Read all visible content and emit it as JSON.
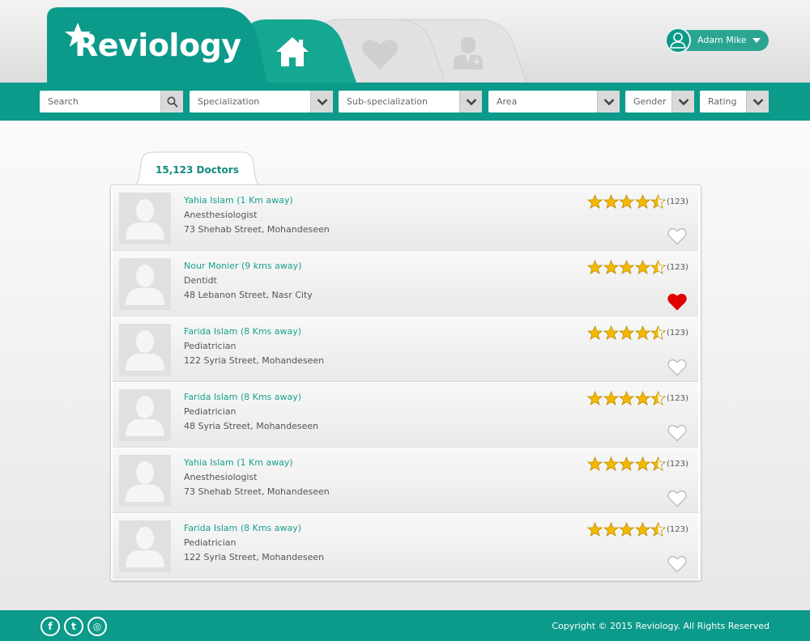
{
  "brand": {
    "name": "Reviology",
    "color": "#0c9a8a"
  },
  "nav": {
    "items": [
      {
        "id": "home",
        "icon": "home-icon",
        "active": true
      },
      {
        "id": "favorites",
        "icon": "heart-icon",
        "active": false
      },
      {
        "id": "doctors",
        "icon": "doctor-icon",
        "active": false
      }
    ]
  },
  "user": {
    "name": "Adam Mike",
    "icon": "user-icon"
  },
  "filters": {
    "search": {
      "placeholder": "Search"
    },
    "specialization": "Specialization",
    "sub_specialization": "Sub-specialization",
    "area": "Area",
    "gender": "Gender",
    "rating": "Rating"
  },
  "list": {
    "title": "15,123 Doctors",
    "doctors": [
      {
        "name": "Yahia Islam (1 Km away)",
        "specialty": "Anesthesiologist",
        "address": "73 Shehab Street, Mohandeseen",
        "rating": 4.5,
        "reviews": "(123)",
        "favorite": false
      },
      {
        "name": "Nour Monier (9 kms away)",
        "specialty": "Dentidt",
        "address": "48 Lebanon Street, Nasr City",
        "rating": 4.5,
        "reviews": "(123)",
        "favorite": true
      },
      {
        "name": "Farida Islam (8 Kms away)",
        "specialty": "Pediatrician",
        "address": "122 Syria Street, Mohandeseen",
        "rating": 4.5,
        "reviews": "(123)",
        "favorite": false
      },
      {
        "name": "Farida Islam (8 Kms away)",
        "specialty": "Pediatrician",
        "address": "48 Syria Street, Mohandeseen",
        "rating": 4.5,
        "reviews": "(123)",
        "favorite": false
      },
      {
        "name": "Yahia Islam (1 Km away)",
        "specialty": "Anesthesiologist",
        "address": "73 Shehab Street, Mohandeseen",
        "rating": 4.5,
        "reviews": "(123)",
        "favorite": false
      },
      {
        "name": "Farida Islam (8 Kms away)",
        "specialty": "Pediatrician",
        "address": "122 Syria Street, Mohandeseen",
        "rating": 4.5,
        "reviews": "(123)",
        "favorite": false
      }
    ]
  },
  "footer": {
    "social": [
      {
        "icon": "facebook-icon",
        "glyph": "f"
      },
      {
        "icon": "twitter-icon",
        "glyph": "t"
      },
      {
        "icon": "instagram-icon",
        "glyph": "◎"
      }
    ],
    "copyright": "Copyright © 2015 Reviology. All Rights Reserved"
  },
  "colors": {
    "accent": "#0c9a8a",
    "link": "#1aa08c",
    "star": "#f5b800",
    "heart_active": "#e00000"
  }
}
